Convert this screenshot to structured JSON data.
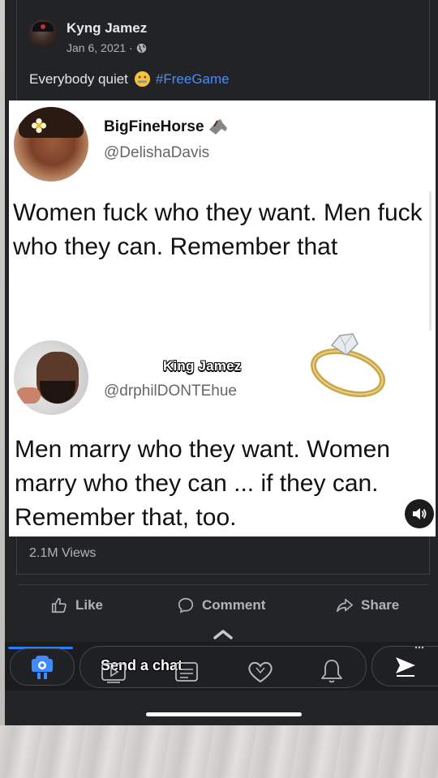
{
  "post": {
    "author": "Kyng Jamez",
    "date": "Jan 6, 2021 ·",
    "caption_text": "Everybody quiet",
    "caption_emoji": "zipper-mouth-face",
    "hashtag": "#FreeGame",
    "views": "2.1M Views"
  },
  "embedded": {
    "tweet1": {
      "display_name": "BigFineHorse",
      "name_emoji": "horse-face",
      "handle": "@DelishaDavis",
      "text": "Women fuck who they want. Men fuck who they can. Remember that"
    },
    "tweet2": {
      "display_name": "King Jamez",
      "handle": "@drphilDONTEhue",
      "text": "Men marry who they want. Women marry who they can ... if they can. Remember that, too.",
      "sticker": "diamond-ring"
    }
  },
  "actions": {
    "like": "Like",
    "comment": "Comment",
    "share": "Share"
  },
  "chat": {
    "placeholder": "Send a chat"
  },
  "colors": {
    "background": "#232427",
    "text_primary": "#e4e6eb",
    "text_secondary": "#b0b3b8",
    "hashtag": "#4c8bf5",
    "accent_blue": "#2d7ff9"
  }
}
